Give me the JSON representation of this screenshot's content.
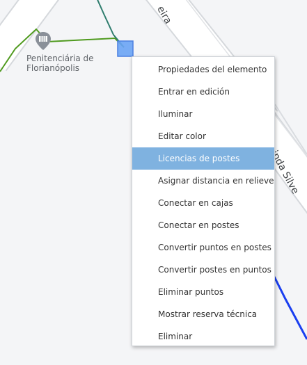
{
  "map": {
    "poi": {
      "icon": "prison-pin-icon",
      "name_line1": "Penitenciária de",
      "name_line2": "Florianópolis"
    },
    "road_labels": [
      "eira",
      "inda Silve"
    ],
    "colors": {
      "background": "#f4f5f7",
      "road_fill": "#ffffff",
      "road_edge": "#d5d8dc",
      "green_route": "#4f9a1e",
      "teal_route": "#2f7d6e",
      "blue_route": "#1a3ff0",
      "selected_node": "#6aa4f4",
      "poi_pin": "#8a9099"
    }
  },
  "context_menu": {
    "items": [
      {
        "label": "Propiedades del elemento"
      },
      {
        "label": "Entrar en edición"
      },
      {
        "label": "Iluminar"
      },
      {
        "label": "Editar color"
      },
      {
        "label": "Licencias de postes",
        "highlighted": true
      },
      {
        "label": "Asignar distancia en relieve"
      },
      {
        "label": "Conectar en cajas"
      },
      {
        "label": "Conectar en postes"
      },
      {
        "label": "Convertir puntos en postes"
      },
      {
        "label": "Convertir postes en puntos"
      },
      {
        "label": "Eliminar puntos"
      },
      {
        "label": "Mostrar reserva técnica"
      },
      {
        "label": "Eliminar"
      }
    ],
    "highlight_color": "#7fb2e0"
  }
}
